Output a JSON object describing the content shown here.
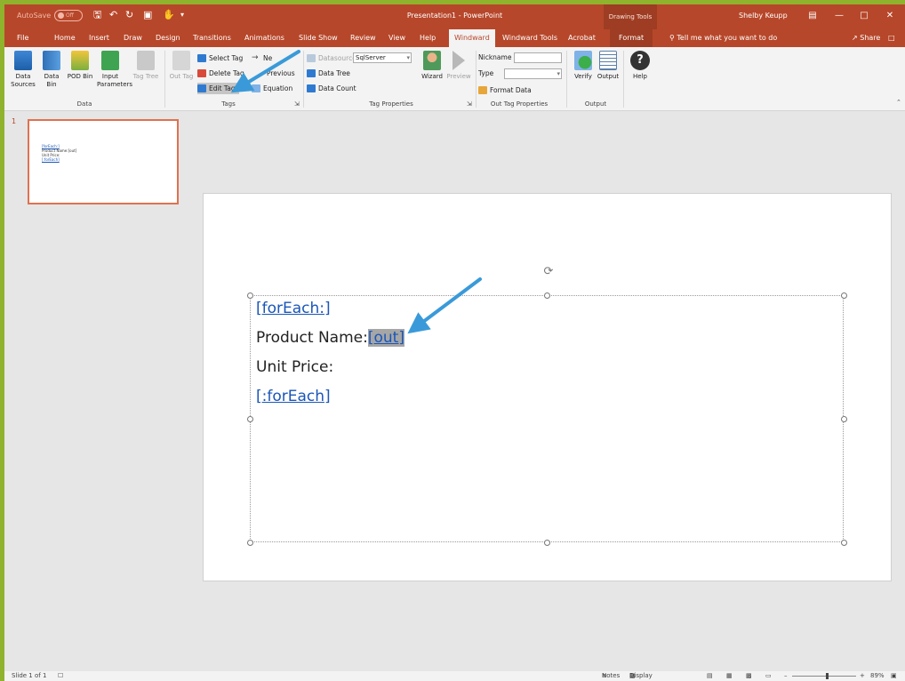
{
  "titlebar": {
    "autosave_label": "AutoSave",
    "autosave_state": "Off",
    "document_title": "Presentation1 - PowerPoint",
    "context_title": "Drawing Tools",
    "user_name": "Shelby Keupp"
  },
  "tabs": [
    {
      "label": "File"
    },
    {
      "label": "Home"
    },
    {
      "label": "Insert"
    },
    {
      "label": "Draw"
    },
    {
      "label": "Design"
    },
    {
      "label": "Transitions"
    },
    {
      "label": "Animations"
    },
    {
      "label": "Slide Show"
    },
    {
      "label": "Review"
    },
    {
      "label": "View"
    },
    {
      "label": "Help"
    },
    {
      "label": "Windward"
    },
    {
      "label": "Windward Tools"
    },
    {
      "label": "Acrobat"
    },
    {
      "label": "Format"
    }
  ],
  "tell_me": "Tell me what you want to do",
  "share_label": "Share",
  "ribbon": {
    "data": {
      "label": "Data",
      "data_sources": "Data Sources",
      "data_bin": "Data Bin",
      "pod_bin": "POD Bin",
      "input_parameters": "Input Parameters",
      "tag_tree": "Tag Tree"
    },
    "tags": {
      "label": "Tags",
      "out_tag": "Out Tag",
      "select_tag": "Select Tag",
      "delete_tag": "Delete Tag",
      "edit_tag": "Edit Tag",
      "next": "Ne",
      "previous": "Previous",
      "equation": "Equation"
    },
    "tag_properties": {
      "label": "Tag Properties",
      "datasource_label": "Datasource",
      "datasource_value": "SqlServer",
      "data_tree": "Data Tree",
      "data_count": "Data Count",
      "wizard": "Wizard",
      "preview": "Preview"
    },
    "out_tag_properties": {
      "label": "Out Tag Properties",
      "nickname_label": "Nickname",
      "type_label": "Type",
      "format_data": "Format Data"
    },
    "output": {
      "label": "Output",
      "verify": "Verify",
      "output": "Output"
    },
    "help": "Help"
  },
  "thumbnail": {
    "number": "1",
    "lines": [
      "[forEach:]",
      "Product Name:[out]",
      "Unit Price:",
      "[:forEach]"
    ]
  },
  "slide": {
    "line1": "[forEach:]",
    "line2_text": "Product Name:",
    "line2_tag": "[out]",
    "line3": "Unit Price:",
    "line4": "[:forEach]"
  },
  "statusbar": {
    "slide_info": "Slide 1 of 1",
    "notes": "Notes",
    "display_settings": "Display Settings",
    "zoom": "89%"
  },
  "colors": {
    "accent": "#b7472a",
    "link": "#1a56b8",
    "annotation_arrow": "#3a9ad9"
  }
}
